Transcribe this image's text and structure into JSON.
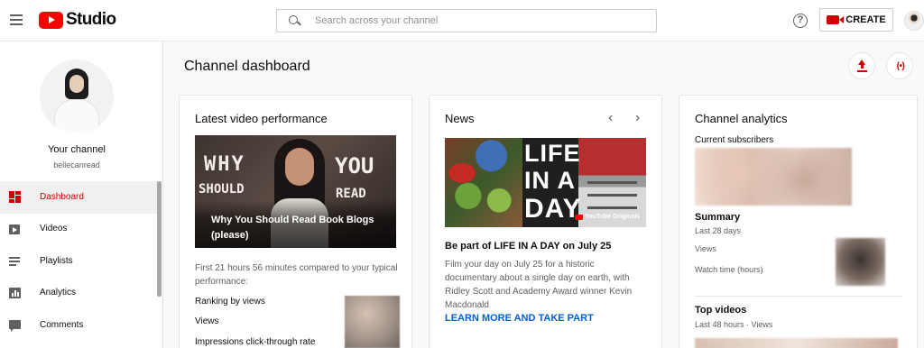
{
  "header": {
    "logo_text": "Studio",
    "search_placeholder": "Search across your channel",
    "create_label": "CREATE",
    "help_glyph": "?"
  },
  "sidebar": {
    "your_channel": "Your channel",
    "handle": "bellecanread",
    "items": [
      {
        "label": "Dashboard",
        "icon": "dashboard-icon",
        "active": true
      },
      {
        "label": "Videos",
        "icon": "videos-icon",
        "active": false
      },
      {
        "label": "Playlists",
        "icon": "playlists-icon",
        "active": false
      },
      {
        "label": "Analytics",
        "icon": "analytics-icon",
        "active": false
      },
      {
        "label": "Comments",
        "icon": "comments-icon",
        "active": false
      }
    ]
  },
  "main": {
    "page_title": "Channel dashboard",
    "live_glyph": "(•)"
  },
  "latest_video": {
    "title": "Latest video performance",
    "thumb_words": [
      "WHY",
      "SHOULD",
      "YOU",
      "READ"
    ],
    "video_title": "Why You Should Read Book Blogs (please)",
    "perf_text": "First 21 hours 56 minutes compared to your typical performance:",
    "metrics": [
      "Ranking by views",
      "Views",
      "Impressions click-through rate"
    ]
  },
  "news": {
    "title": "News",
    "prev_glyph": "‹",
    "next_glyph": "›",
    "image_words": [
      "LIFE",
      "IN A",
      "DAY"
    ],
    "badge": "YouTube Originals",
    "headline": "Be part of LIFE IN A DAY on July 25",
    "body": "Film your day on July 25 for a historic documentary about a single day on earth, with Ridley Scott and Academy Award winner Kevin Macdonald",
    "link": "LEARN MORE AND TAKE PART"
  },
  "channel_analytics": {
    "title": "Channel analytics",
    "subscribers_label": "Current subscribers",
    "summary_label": "Summary",
    "summary_period": "Last 28 days",
    "views_label": "Views",
    "watch_time_label": "Watch time (hours)",
    "top_videos_label": "Top videos",
    "top_videos_period": "Last 48 hours · Views"
  },
  "colors": {
    "brand_red": "#ff0000",
    "accent_red": "#cc0000",
    "link_blue": "#065fd4"
  }
}
